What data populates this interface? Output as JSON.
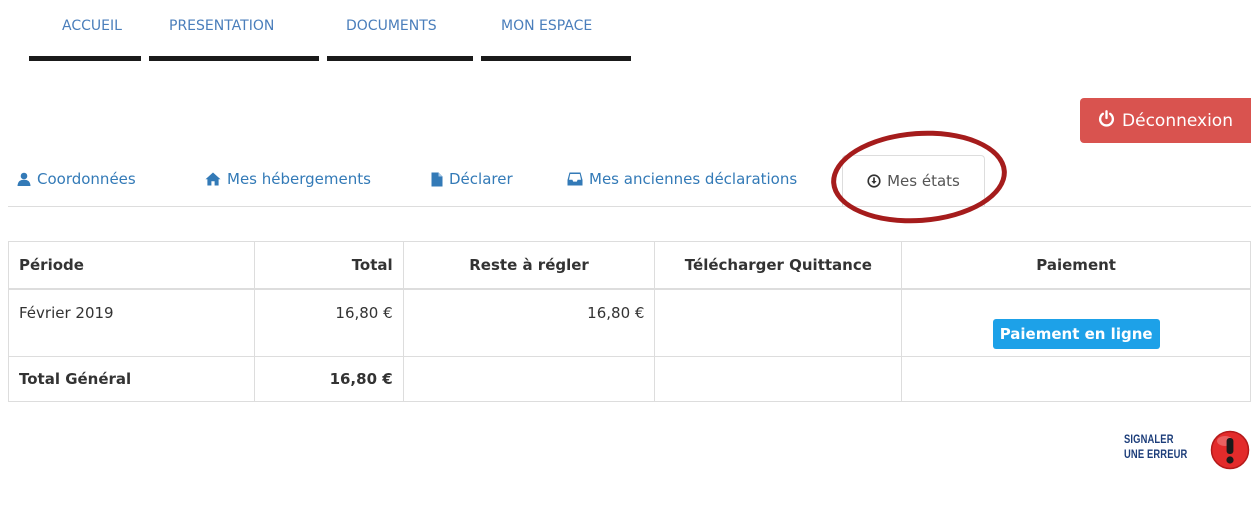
{
  "nav": {
    "items": [
      {
        "label": "ACCUEIL"
      },
      {
        "label": "PRESENTATION"
      },
      {
        "label": "DOCUMENTS"
      },
      {
        "label": "MON ESPACE"
      }
    ]
  },
  "logout": {
    "label": "Déconnexion",
    "icon": "power-icon",
    "color": "#d9534f"
  },
  "tabs": {
    "items": [
      {
        "label": "Coordonnées",
        "icon": "user-icon"
      },
      {
        "label": "Mes hébergements",
        "icon": "home-icon"
      },
      {
        "label": "Déclarer",
        "icon": "file-icon"
      },
      {
        "label": "Mes anciennes déclarations",
        "icon": "inbox-icon"
      },
      {
        "label": "Mes états",
        "icon": "download-circle-icon",
        "active": true
      }
    ],
    "link_color": "#337ab7"
  },
  "table": {
    "headers": [
      "Période",
      "Total",
      "Reste à régler",
      "Télécharger Quittance",
      "Paiement"
    ],
    "rows": [
      {
        "periode": "Février 2019",
        "total": "16,80 €",
        "reste": "16,80 €",
        "quittance": "",
        "paiement": "Paiement en ligne"
      }
    ],
    "footer": {
      "label": "Total Général",
      "total": "16,80 €"
    }
  },
  "report": {
    "line1": "SIGNALER",
    "line2": "UNE ERREUR",
    "icon": "alert-icon"
  },
  "colors": {
    "pay_button": "#1da1e8",
    "highlight_ring": "#a51c1c"
  }
}
